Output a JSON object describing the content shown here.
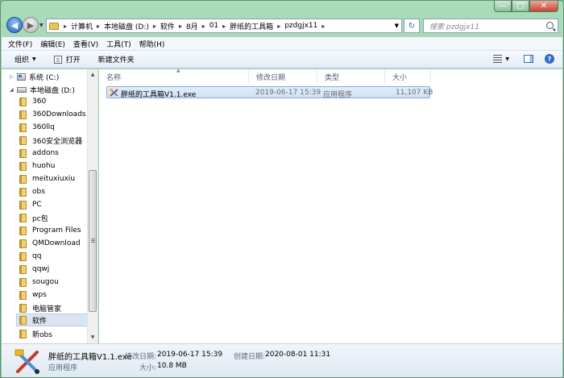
{
  "window": {
    "min_glyph": "—",
    "max_glyph": "□",
    "close_glyph": "✕"
  },
  "address": {
    "crumbs": [
      "计算机",
      "本地磁盘 (D:)",
      "软件",
      "8月",
      "01",
      "胖纸的工具箱",
      "pzdgjx11"
    ],
    "search_placeholder": "搜索 pzdgjx11"
  },
  "menu": [
    "文件(F)",
    "编辑(E)",
    "查看(V)",
    "工具(T)",
    "帮助(H)"
  ],
  "toolbar": {
    "organize": "组织",
    "open": "打开",
    "new_folder": "新建文件夹",
    "help_glyph": "?"
  },
  "sidebar": {
    "drives": [
      {
        "label": "系统 (C:)"
      },
      {
        "label": "本地磁盘 (D:)"
      }
    ],
    "folders": [
      "360",
      "360Downloads",
      "360llq",
      "360安全浏览器",
      "addons",
      "huohu",
      "meituxiuxiu",
      "obs",
      "PC",
      "pc包",
      "Program Files",
      "QMDownload",
      "qq",
      "qqwj",
      "sougou",
      "wps",
      "电脑管家",
      "软件",
      "新obs"
    ],
    "selected": "软件"
  },
  "columns": {
    "name": "名称",
    "modified": "修改日期",
    "type": "类型",
    "size": "大小"
  },
  "files": [
    {
      "name": "胖纸的工具箱V1.1.exe",
      "modified": "2019-06-17 15:39",
      "type": "应用程序",
      "size": "11,107 KB"
    }
  ],
  "details": {
    "name": "胖纸的工具箱V1.1.exe",
    "type": "应用程序",
    "modified_label": "修改日期:",
    "modified": "2019-06-17 15:39",
    "created_label": "创建日期:",
    "created": "2020-08-01 11:31",
    "size_label": "大小:",
    "size": "10.8 MB"
  }
}
